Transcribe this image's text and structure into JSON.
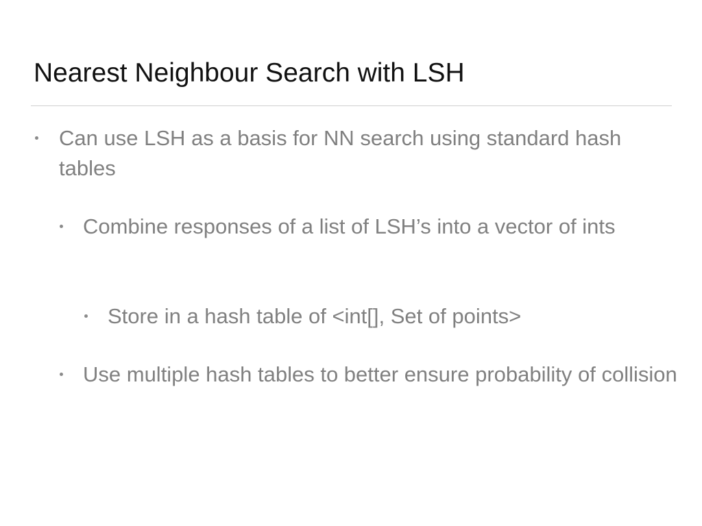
{
  "slide": {
    "title": "Nearest Neighbour Search with LSH",
    "bullets": [
      {
        "level": 0,
        "text": "Can use LSH as a basis for NN search using standard hash tables"
      },
      {
        "level": 1,
        "text": "Combine responses of a list of LSH’s into a vector of ints"
      },
      {
        "level": 2,
        "text": "Store in a hash table of <int[], Set of points>"
      },
      {
        "level": 1,
        "text": "Use multiple hash tables to better ensure probability of collision"
      }
    ]
  },
  "colors": {
    "title": "#111111",
    "body_text": "#808080",
    "rule": "#cfcfcf",
    "background": "#ffffff"
  }
}
